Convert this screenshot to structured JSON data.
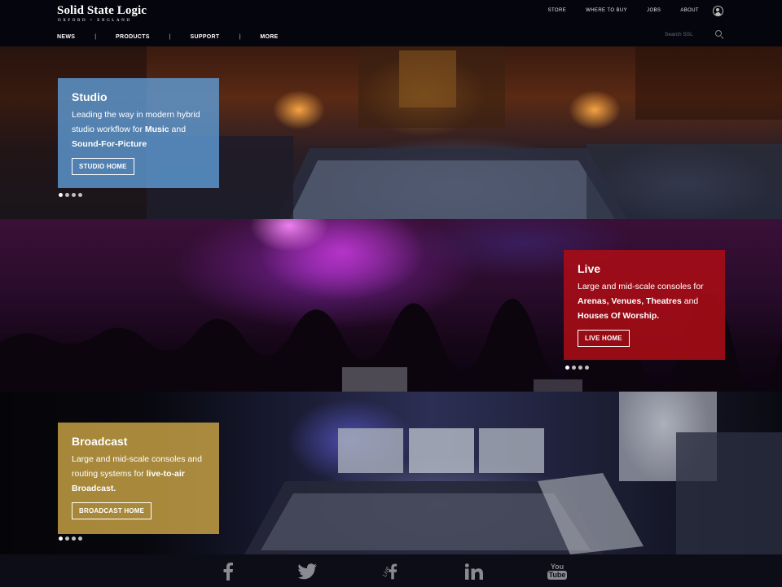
{
  "header": {
    "logo_title": "Solid State Logic",
    "logo_subtitle": "OXFORD • ENGLAND",
    "top_links": [
      "STORE",
      "WHERE TO BUY",
      "JOBS",
      "ABOUT"
    ],
    "nav": [
      "NEWS",
      "PRODUCTS",
      "SUPPORT",
      "MORE"
    ],
    "nav_separator": "|",
    "search_placeholder": "Search SSL"
  },
  "panels": {
    "studio": {
      "title": "Studio",
      "text_1": "Leading the way in modern hybrid studio workflow for ",
      "bold_1": "Music",
      "text_2": " and ",
      "bold_2": "Sound-For-Picture",
      "button": "STUDIO HOME",
      "accent": "#60a0dc"
    },
    "live": {
      "title": "Live",
      "text_1": "Large and mid-scale consoles for ",
      "bold_1": "Arenas, Venues, Theatres",
      "text_2": " and ",
      "bold_2": "Houses Of Worship.",
      "button": "LIVE HOME",
      "accent": "#aa0c16"
    },
    "broadcast": {
      "title": "Broadcast",
      "text_1": "Large and mid-scale consoles and routing systems for ",
      "bold_1": "live-to-air Broadcast.",
      "button": "BROADCAST HOME",
      "accent": "#c4a044"
    }
  },
  "carousel": {
    "dot_count": 4,
    "active_index": 0
  },
  "footer": {
    "social_icons": [
      "facebook-icon",
      "twitter-icon",
      "live-facebook-icon",
      "linkedin-icon",
      "youtube-icon"
    ],
    "live_label": "Live",
    "youtube_label_1": "You",
    "youtube_label_2": "Tube"
  }
}
